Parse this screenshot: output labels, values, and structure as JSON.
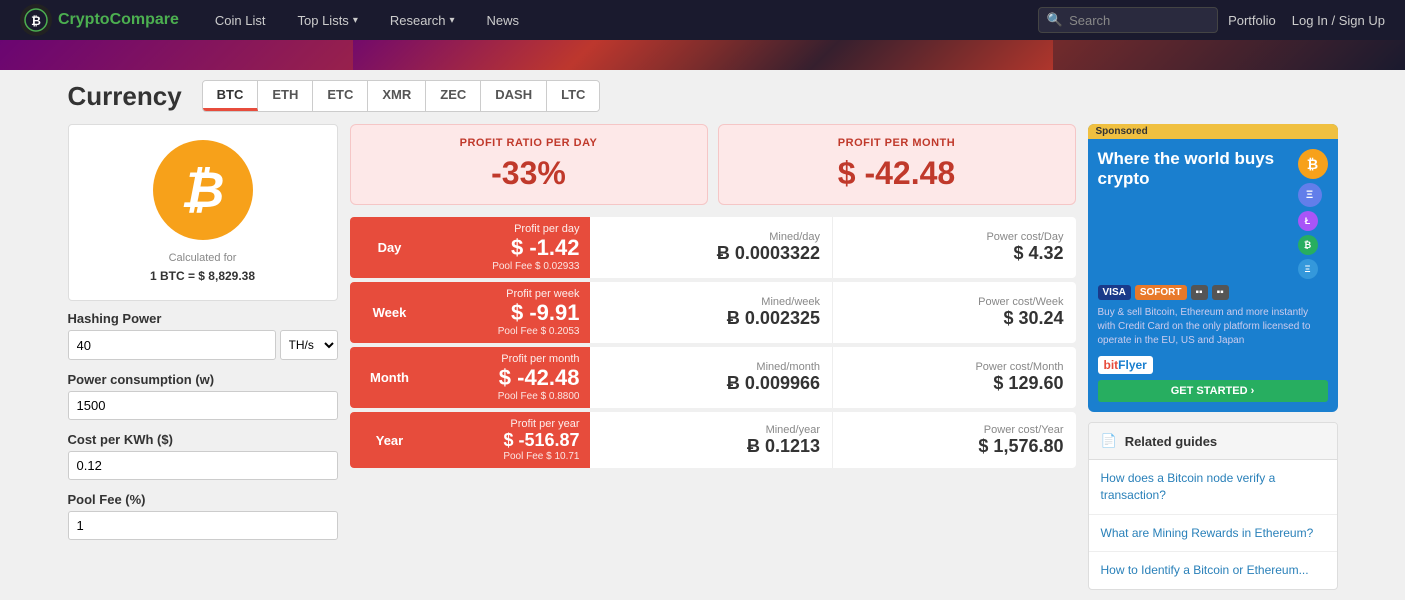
{
  "nav": {
    "logo_text_1": "Crypto",
    "logo_text_2": "Compare",
    "items": [
      {
        "label": "Coin List",
        "has_dropdown": false
      },
      {
        "label": "Top Lists",
        "has_dropdown": true
      },
      {
        "label": "Research",
        "has_dropdown": true
      },
      {
        "label": "News",
        "has_dropdown": false
      }
    ],
    "search_placeholder": "Search",
    "portfolio": "Portfolio",
    "login": "Log In / Sign Up"
  },
  "page": {
    "title": "Currency",
    "tabs": [
      {
        "label": "BTC",
        "active": true
      },
      {
        "label": "ETH",
        "active": false
      },
      {
        "label": "ETC",
        "active": false
      },
      {
        "label": "XMR",
        "active": false
      },
      {
        "label": "ZEC",
        "active": false
      },
      {
        "label": "DASH",
        "active": false
      },
      {
        "label": "LTC",
        "active": false
      }
    ]
  },
  "coin": {
    "calculated_for_line1": "Calculated for",
    "calculated_for_line2": "1 BTC = $ 8,829.38"
  },
  "inputs": {
    "hashing_power_label": "Hashing Power",
    "hashing_power_value": "40",
    "hashing_power_unit": "TH/s",
    "power_consumption_label": "Power consumption (w)",
    "power_consumption_value": "1500",
    "cost_per_kwh_label": "Cost per KWh ($)",
    "cost_per_kwh_value": "0.12",
    "pool_fee_label": "Pool Fee (%)",
    "pool_fee_value": "1"
  },
  "profit_summary": {
    "ratio_label": "PROFIT RATIO PER DAY",
    "ratio_value": "-33%",
    "month_label": "PROFIT PER MONTH",
    "month_value": "$ -42.48"
  },
  "profit_rows": [
    {
      "period": "Day",
      "profit_label": "Profit per day",
      "profit_value": "$ -1.42",
      "pool_fee": "Pool Fee $ 0.02933",
      "mined_label": "Mined/day",
      "mined_value": "Ƀ 0.0003322",
      "power_label": "Power cost/Day",
      "power_value": "$ 4.32"
    },
    {
      "period": "Week",
      "profit_label": "Profit per week",
      "profit_value": "$ -9.91",
      "pool_fee": "Pool Fee $ 0.2053",
      "mined_label": "Mined/week",
      "mined_value": "Ƀ 0.002325",
      "power_label": "Power cost/Week",
      "power_value": "$ 30.24"
    },
    {
      "period": "Month",
      "profit_label": "Profit per month",
      "profit_value": "$ -42.48",
      "pool_fee": "Pool Fee $ 0.8800",
      "mined_label": "Mined/month",
      "mined_value": "Ƀ 0.009966",
      "power_label": "Power cost/Month",
      "power_value": "$ 129.60"
    },
    {
      "period": "Year",
      "profit_label": "Profit per year",
      "profit_value": "$ -516.87",
      "pool_fee": "Pool Fee $ 10.71",
      "mined_label": "Mined/year",
      "mined_value": "Ƀ 0.1213",
      "power_label": "Power cost/Year",
      "power_value": "$ 1,576.80"
    }
  ],
  "ad": {
    "sponsored": "Sponsored",
    "headline": "Where the world buys crypto",
    "description": "Buy & sell Bitcoin, Ethereum and more instantly with Credit Card on the only platform licensed to operate in the EU, US and Japan",
    "brand": "bitFlyer",
    "cta": "GET STARTED ›"
  },
  "related_guides": {
    "header": "Related guides",
    "items": [
      "How does a Bitcoin node verify a transaction?",
      "What are Mining Rewards in Ethereum?",
      "How to Identify a Bitcoin or Ethereum..."
    ]
  },
  "colors": {
    "red": "#e74c3c",
    "orange": "#f7a11a",
    "green": "#27ae60",
    "blue": "#1a7fcf",
    "light_red_bg": "#fde8e8"
  }
}
